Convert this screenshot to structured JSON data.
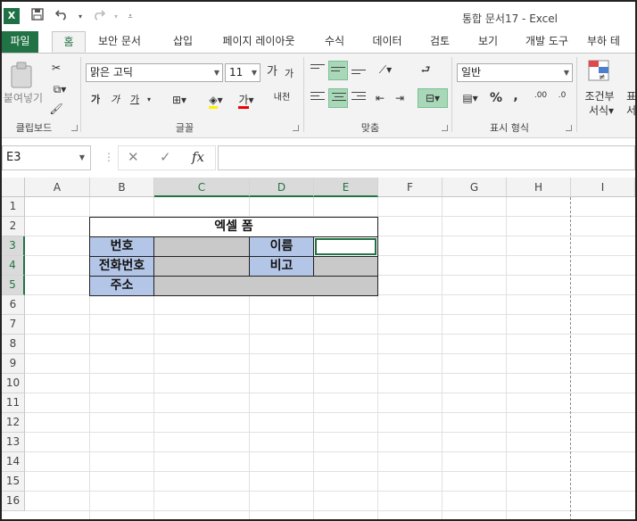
{
  "titlebar": {
    "doc_title": "통합 문서17 - Excel",
    "logo": "X",
    "quick_access": {
      "save_icon": "floppy-disk",
      "undo_icon": "undo-arrow",
      "redo_icon": "redo-arrow",
      "customize_icon": "dropdown-caret"
    }
  },
  "tabs": [
    {
      "label": "파일"
    },
    {
      "label": "홈"
    },
    {
      "label": "보안 문서"
    },
    {
      "label": "삽입"
    },
    {
      "label": "페이지 레이아웃"
    },
    {
      "label": "수식"
    },
    {
      "label": "데이터"
    },
    {
      "label": "검토"
    },
    {
      "label": "보기"
    },
    {
      "label": "개발 도구"
    },
    {
      "label": "부하 테"
    }
  ],
  "ribbon": {
    "clipboard": {
      "paste_label": "붙여넣기",
      "group_label": "클립보드"
    },
    "font": {
      "name": "맑은 고딕",
      "size": "11",
      "grow_label": "가",
      "shrink_label": "가",
      "bold_label": "가",
      "italic_label": "가",
      "underline_label": "가",
      "font_color_label": "가",
      "phonetic_label": "내천",
      "group_label": "글꼴"
    },
    "alignment": {
      "group_label": "맞춤"
    },
    "number": {
      "format": "일반",
      "percent": "%",
      "comma": ",",
      "group_label": "표시 형식",
      "inc_decimal": ".00",
      "dec_decimal": ".0"
    },
    "styles": {
      "conditional_line1": "조건부",
      "conditional_line2": "서식",
      "format_cut": "표",
      "format_cut2": "서식"
    }
  },
  "formula_bar": {
    "name_box": "E3",
    "cancel": "✕",
    "enter": "✓",
    "fx": "fx",
    "value": ""
  },
  "columns": [
    "A",
    "B",
    "C",
    "D",
    "E",
    "F",
    "G",
    "H",
    "I"
  ],
  "rows": [
    "1",
    "2",
    "3",
    "4",
    "5",
    "6",
    "7",
    "8",
    "9",
    "10",
    "11",
    "12",
    "13",
    "14",
    "15",
    "16"
  ],
  "form": {
    "title": "엑셀 폼",
    "number_label": "번호",
    "name_label": "이름",
    "phone_label": "전화번호",
    "note_label": "비고",
    "address_label": "주소"
  },
  "colors": {
    "excel_green": "#217346",
    "label_blue": "#b4c6e7",
    "input_grey": "#c9c9c9",
    "highlight": "#a8d8b8"
  }
}
